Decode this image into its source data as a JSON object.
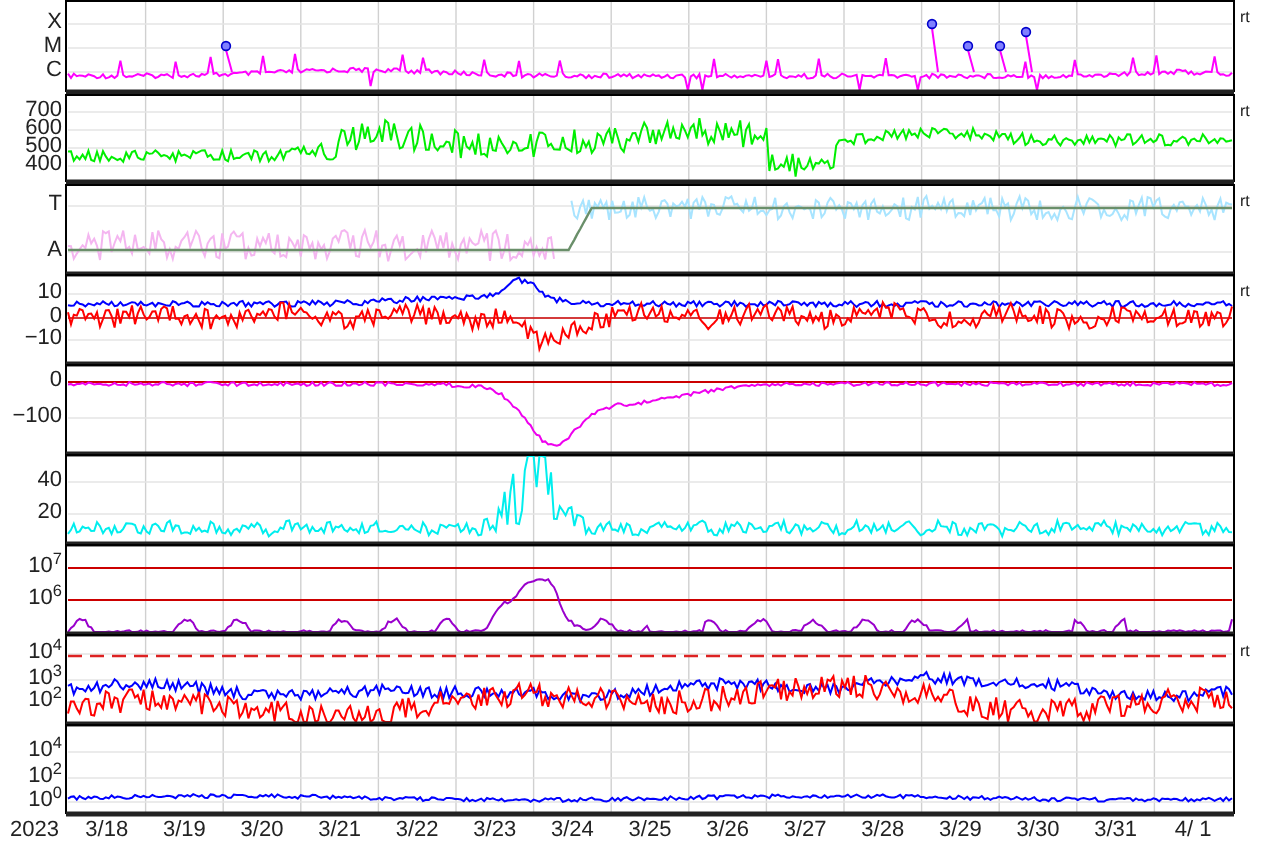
{
  "panels": [
    {
      "y_ticks": [
        "X",
        "M",
        "C"
      ],
      "side_label": "rt",
      "traces": [
        {
          "color": "#ff00ff"
        }
      ],
      "markers": true
    },
    {
      "y_ticks": [
        "700",
        "600",
        "500",
        "400"
      ],
      "side_label": "rt",
      "traces": [
        {
          "color": "#00ee00"
        }
      ]
    },
    {
      "y_ticks": [
        "T",
        "A"
      ],
      "side_label": "rt",
      "traces": [
        {
          "color": "#f4b6f0"
        },
        {
          "color": "#a8e4ff"
        },
        {
          "color": "#6a8f6a"
        }
      ]
    },
    {
      "y_ticks": [
        "10",
        "0",
        "−10"
      ],
      "side_label": "rt",
      "traces": [
        {
          "color": "#0000ff"
        },
        {
          "color": "#ff0000"
        }
      ]
    },
    {
      "y_ticks": [
        "0",
        "−100"
      ],
      "traces": [
        {
          "color": "#ee00ee"
        }
      ]
    },
    {
      "y_ticks": [
        "40",
        "20"
      ],
      "traces": [
        {
          "color": "#00eeee"
        }
      ]
    },
    {
      "y_ticks": [
        "10$^{7}$",
        "10$^{6}$"
      ],
      "traces": [
        {
          "color": "#9900cc"
        }
      ]
    },
    {
      "y_ticks": [
        "10$^{4}$",
        "10$^{3}$",
        "10$^{2}$"
      ],
      "side_label": "rt",
      "traces": [
        {
          "color": "#0000ff"
        },
        {
          "color": "#ff0000"
        }
      ]
    },
    {
      "y_ticks": [
        "10$^{4}$",
        "10$^{2}$",
        "10$^{0}$"
      ],
      "traces": [
        {
          "color": "#0000ff"
        }
      ]
    }
  ],
  "year_label": "2023",
  "x_ticks": [
    "3/18",
    "3/19",
    "3/20",
    "3/21",
    "3/22",
    "3/23",
    "3/24",
    "3/25",
    "3/26",
    "3/27",
    "3/28",
    "3/29",
    "3/30",
    "3/31",
    "4/ 1"
  ]
}
